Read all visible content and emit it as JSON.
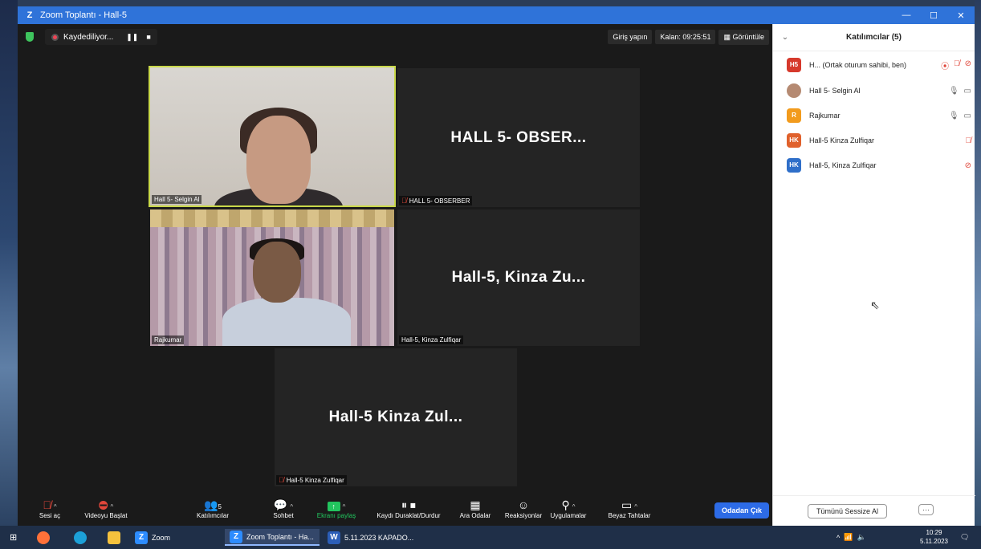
{
  "window": {
    "title": "Zoom Toplantı - Hall-5",
    "logo": "Z",
    "minimize": "—",
    "maximize": "☐",
    "close": "✕"
  },
  "topbar": {
    "recording_label": "Kaydediliyor...",
    "pause_glyph": "❚❚",
    "stop_glyph": "■",
    "signin": "Giriş yapın",
    "remaining": "Kalan: 09:25:51",
    "view": "Görüntüle",
    "view_icon": "grid-icon"
  },
  "tiles": [
    {
      "label": "Hall 5- Selgin Al",
      "big_name": ""
    },
    {
      "label": "HALL 5- OBSERBER",
      "big_name": "HALL 5- OBSER..."
    },
    {
      "label": "Rajkumar",
      "big_name": ""
    },
    {
      "label": "Hall-5, Kinza Zulfiqar",
      "big_name": "Hall-5, Kinza Zu..."
    },
    {
      "label": "Hall-5 Kinza Zulfiqar",
      "big_name": "Hall-5 Kinza Zul..."
    }
  ],
  "toolbar": {
    "unmute": "Sesi aç",
    "start_video": "Videoyu Başlat",
    "participants": "Katılımcılar",
    "participants_count": "5",
    "chat": "Sohbet",
    "share": "Ekranı paylaş",
    "record": "Kaydı Duraklat/Durdur",
    "breakout": "Ara Odalar",
    "reactions": "Reaksiyonlar",
    "apps": "Uygulamalar",
    "whiteboard": "Beyaz Tahtalar",
    "leave": "Odadan Çık",
    "share_color": "#22c55e"
  },
  "panel": {
    "title": "Katılımcılar (5)",
    "participants": [
      {
        "initials": "H5",
        "name": "H... (Ortak oturum sahibi, ben)",
        "color": "#d6392c"
      },
      {
        "initials": "",
        "name": "Hall 5- Selgin Al",
        "color": "#b58a72"
      },
      {
        "initials": "R",
        "name": "Rajkumar",
        "color": "#f29b1d"
      },
      {
        "initials": "HK",
        "name": "Hall-5 Kinza Zulfiqar",
        "color": "#e0612c"
      },
      {
        "initials": "HK",
        "name": "Hall-5, Kinza Zulfiqar",
        "color": "#2f6fc9"
      }
    ],
    "mute_all": "Tümünü Sessize Al",
    "more": "···"
  },
  "taskbar": {
    "zoom": "Zoom",
    "meeting_window": "Zoom Toplantı - Ha...",
    "doc_window": "5.11.2023 KAPADO...",
    "time": "10:29",
    "date": "5.11.2023"
  }
}
